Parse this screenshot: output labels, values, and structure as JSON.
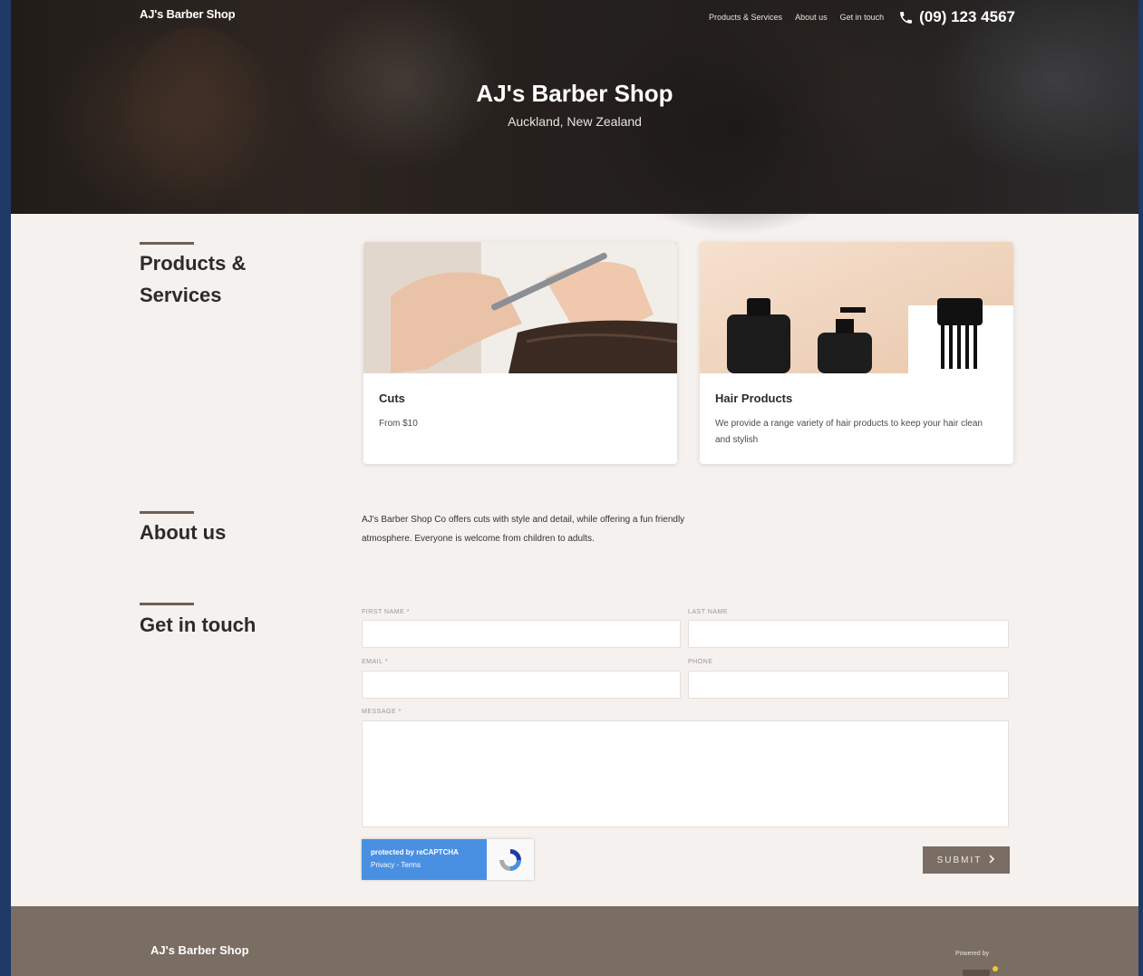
{
  "header": {
    "logo": "AJ's Barber Shop",
    "nav": [
      "Products & Services",
      "About us",
      "Get in touch"
    ],
    "phone": "(09) 123 4567"
  },
  "hero": {
    "title": "AJ's Barber Shop",
    "subtitle": "Auckland, New Zealand"
  },
  "sections": {
    "products_title_line1": "Products &",
    "products_title_line2": "Services",
    "about_title": "About us",
    "contact_title": "Get in touch"
  },
  "cards": [
    {
      "title": "Cuts",
      "desc": "From $10",
      "image": "haircut-scissors-photo"
    },
    {
      "title": "Hair Products",
      "desc": "We provide a range variety of hair products to keep your hair clean and stylish",
      "image": "hair-products-bottles-photo"
    }
  ],
  "about": {
    "text": "AJ's Barber Shop Co offers cuts with style and detail, while offering a fun friendly atmosphere. Everyone is welcome from children to adults."
  },
  "form": {
    "first_name_label": "FIRST NAME *",
    "last_name_label": "LAST NAME",
    "email_label": "EMAIL *",
    "phone_label": "PHONE",
    "message_label": "MESSAGE *",
    "first_name_value": "",
    "last_name_value": "",
    "email_value": "",
    "phone_value": "",
    "message_value": "",
    "recaptcha_line1": "protected by reCAPTCHA",
    "recaptcha_line2": "Privacy - Terms",
    "submit_label": "SUBMIT"
  },
  "footer": {
    "logo": "AJ's Barber Shop",
    "powered_by": "Powered by"
  },
  "colors": {
    "footer_bg": "#7a6d62",
    "page_bg": "#f5f1ee",
    "submit_bg": "#7a6d63",
    "recaptcha_blue": "#4a90e2"
  }
}
